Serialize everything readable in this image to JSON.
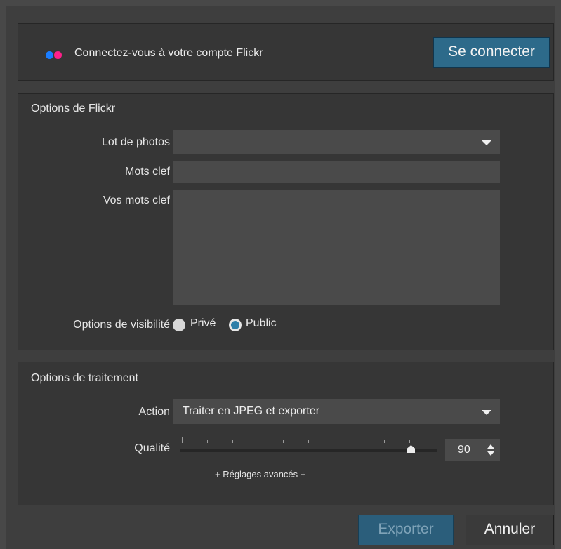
{
  "login": {
    "text": "Connectez-vous à votre compte Flickr",
    "connect_label": "Se connecter",
    "dot_colors": [
      "#1a7dff",
      "#ff1f8a"
    ]
  },
  "flickr_options": {
    "title": "Options de Flickr",
    "photoset_label": "Lot de photos",
    "photoset_value": "",
    "keywords_label": "Mots clef",
    "keywords_value": "",
    "your_keywords_label": "Vos mots clef",
    "your_keywords_value": "",
    "visibility_label": "Options de visibilité",
    "visibility_options": [
      "Privé",
      "Public"
    ],
    "visibility_selected": "Public"
  },
  "processing": {
    "title": "Options de traitement",
    "action_label": "Action",
    "action_value": "Traiter en JPEG et exporter",
    "quality_label": "Qualité",
    "quality_value": "90",
    "quality_fraction": 0.9,
    "advanced_label": "+ Réglages avancés +"
  },
  "footer": {
    "export_label": "Exporter",
    "cancel_label": "Annuler"
  },
  "colors": {
    "accent": "#2d6a8a",
    "background": "#3e3e3e",
    "panel": "#363636"
  }
}
